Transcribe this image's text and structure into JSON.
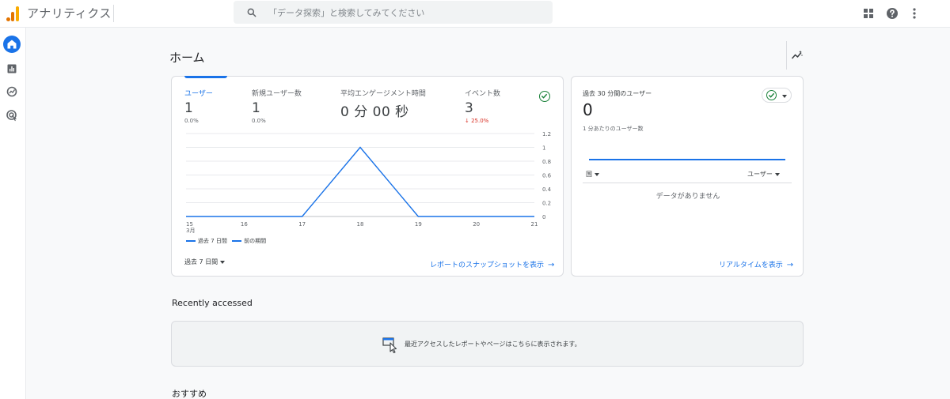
{
  "app": {
    "title": "アナリティクス",
    "search_placeholder": "「データ探索」と検索してみてください",
    "topbar_icons": [
      "apps-grid-icon",
      "help-icon",
      "more-vert-icon"
    ]
  },
  "nav": {
    "items": [
      {
        "name": "home",
        "icon": "home-icon",
        "active": true
      },
      {
        "name": "reports",
        "icon": "bar-chart-icon",
        "active": false
      },
      {
        "name": "explore",
        "icon": "explore-icon",
        "active": false
      },
      {
        "name": "advertising",
        "icon": "target-icon",
        "active": false
      }
    ]
  },
  "page": {
    "title": "ホーム"
  },
  "overview": {
    "metrics": [
      {
        "label": "ユーザー",
        "value": "1",
        "delta": "0.0%",
        "active": true
      },
      {
        "label": "新規ユーザー数",
        "value": "1",
        "delta": "0.0%",
        "active": false
      },
      {
        "label": "平均エンゲージメント時間",
        "value": "0 分 00 秒",
        "delta": "",
        "active": false
      },
      {
        "label": "イベント数",
        "value": "3",
        "delta": "25.0%",
        "delta_direction": "down",
        "active": false
      }
    ],
    "legend": {
      "current": "過去 7 日間",
      "previous": "前の期間"
    },
    "date_range": "過去 7 日間",
    "link": "レポートのスナップショットを表示"
  },
  "chart_data": {
    "type": "line",
    "x": [
      "15",
      "16",
      "17",
      "18",
      "19",
      "20",
      "21"
    ],
    "x_sublabel": "3月",
    "series": [
      {
        "name": "過去 7 日間",
        "values": [
          0,
          0,
          0,
          1,
          0,
          0,
          0
        ],
        "color": "#1a73e8"
      }
    ],
    "yticks": [
      "0",
      "0.2",
      "0.4",
      "0.6",
      "0.8",
      "1",
      "1.2"
    ],
    "ylim": [
      0,
      1.2
    ],
    "grid": true,
    "legend_position": "bottom-left"
  },
  "realtime": {
    "label": "過去 30 分間のユーザー",
    "value": "0",
    "sublabel": "1 分あたりのユーザー数",
    "col_country": "国",
    "col_users": "ユーザー",
    "empty_text": "データがありません",
    "link": "リアルタイムを表示"
  },
  "recent": {
    "title": "Recently accessed",
    "empty_text": "最近アクセスしたレポートやページはこちらに表示されます。"
  },
  "recommend": {
    "title": "おすすめ"
  },
  "colors": {
    "accent": "#1a73e8",
    "success": "#188038",
    "negative": "#d93025"
  }
}
